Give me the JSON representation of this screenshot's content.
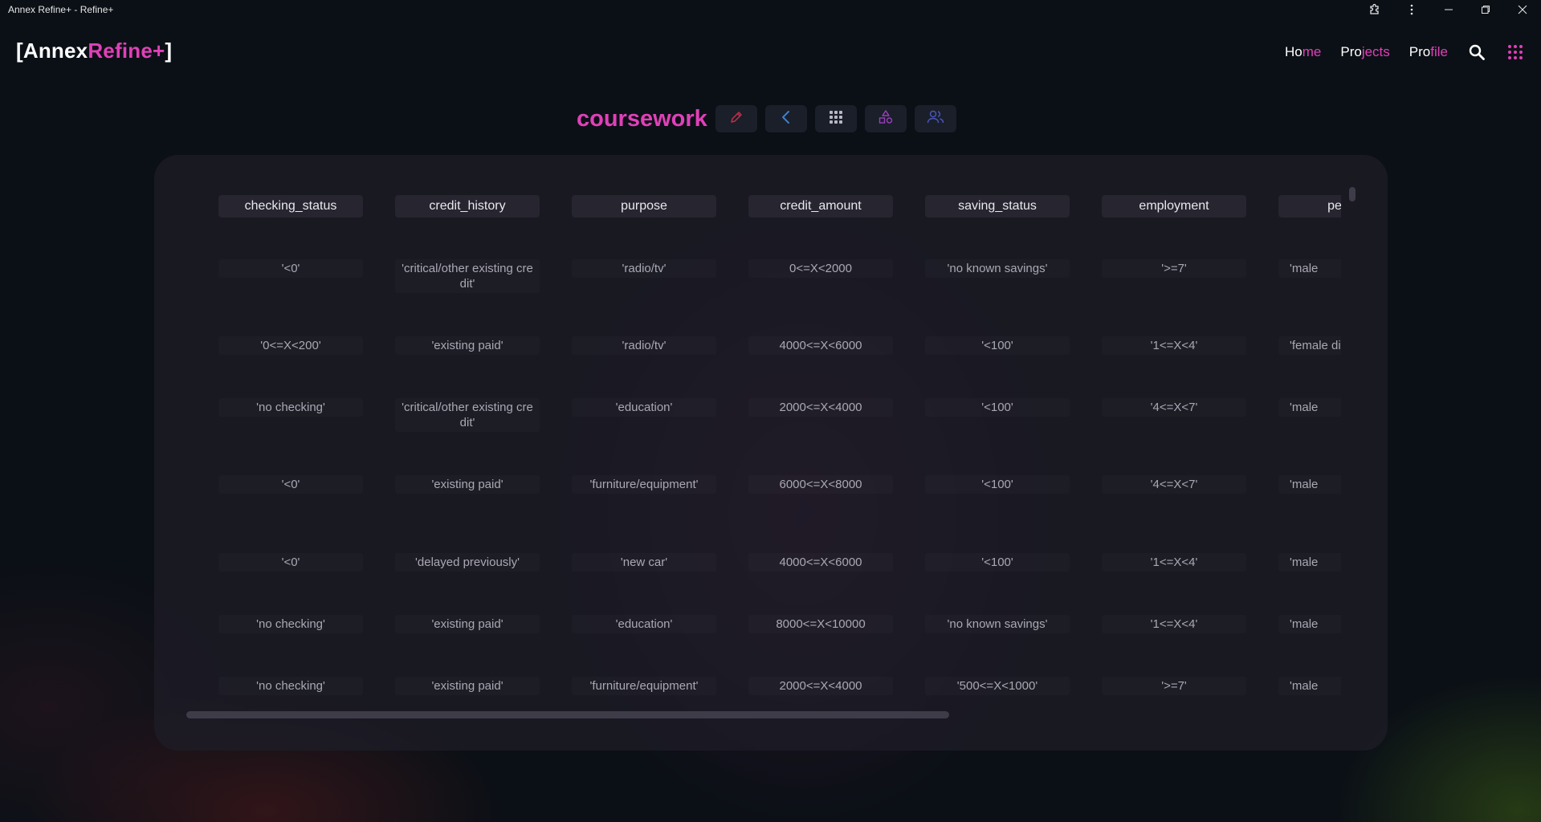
{
  "window": {
    "title": "Annex Refine+ - Refine+"
  },
  "logo": {
    "open_bracket": "[",
    "part1": "Annex",
    "part2": "Refine+",
    "close_bracket": "]"
  },
  "nav": {
    "home": {
      "a": "Ho",
      "b": "me"
    },
    "projects": {
      "a": "Pro",
      "b": "jects"
    },
    "profile": {
      "a": "Pro",
      "b": "file"
    }
  },
  "project": {
    "title": "coursework"
  },
  "table": {
    "columns": [
      "checking_status",
      "credit_history",
      "purpose",
      "credit_amount",
      "saving_status",
      "employment",
      "persona"
    ],
    "rows": [
      [
        "'<0'",
        "'critical/other existing credit'",
        "'radio/tv'",
        "0<=X<2000",
        "'no known savings'",
        "'>=7'",
        "'male"
      ],
      [
        "'0<=X<200'",
        "'existing paid'",
        "'radio/tv'",
        "4000<=X<6000",
        "'<100'",
        "'1<=X<4'",
        "'female di"
      ],
      [
        "'no checking'",
        "'critical/other existing credit'",
        "'education'",
        "2000<=X<4000",
        "'<100'",
        "'4<=X<7'",
        "'male"
      ],
      [
        "'<0'",
        "'existing paid'",
        "'furniture/equipment'",
        "6000<=X<8000",
        "'<100'",
        "'4<=X<7'",
        "'male"
      ],
      [
        "'<0'",
        "'delayed previously'",
        "'new car'",
        "4000<=X<6000",
        "'<100'",
        "'1<=X<4'",
        "'male"
      ],
      [
        "'no checking'",
        "'existing paid'",
        "'education'",
        "8000<=X<10000",
        "'no known savings'",
        "'1<=X<4'",
        "'male"
      ],
      [
        "'no checking'",
        "'existing paid'",
        "'furniture/equipment'",
        "2000<=X<4000",
        "'500<=X<1000'",
        "'>=7'",
        "'male"
      ]
    ]
  },
  "colors": {
    "accent": "#e040b8",
    "background": "#0b1016",
    "panel": "#1e1c26"
  },
  "icons": {
    "titlebar": [
      "extension-icon",
      "more-vert-icon",
      "minimize-icon",
      "restore-icon",
      "close-icon"
    ],
    "nav": [
      "search-icon",
      "apps-grid-icon"
    ],
    "toolbar": [
      "edit-pencil-icon",
      "back-chevron-icon",
      "grid-dots-icon",
      "shapes-icon",
      "users-icon"
    ]
  }
}
